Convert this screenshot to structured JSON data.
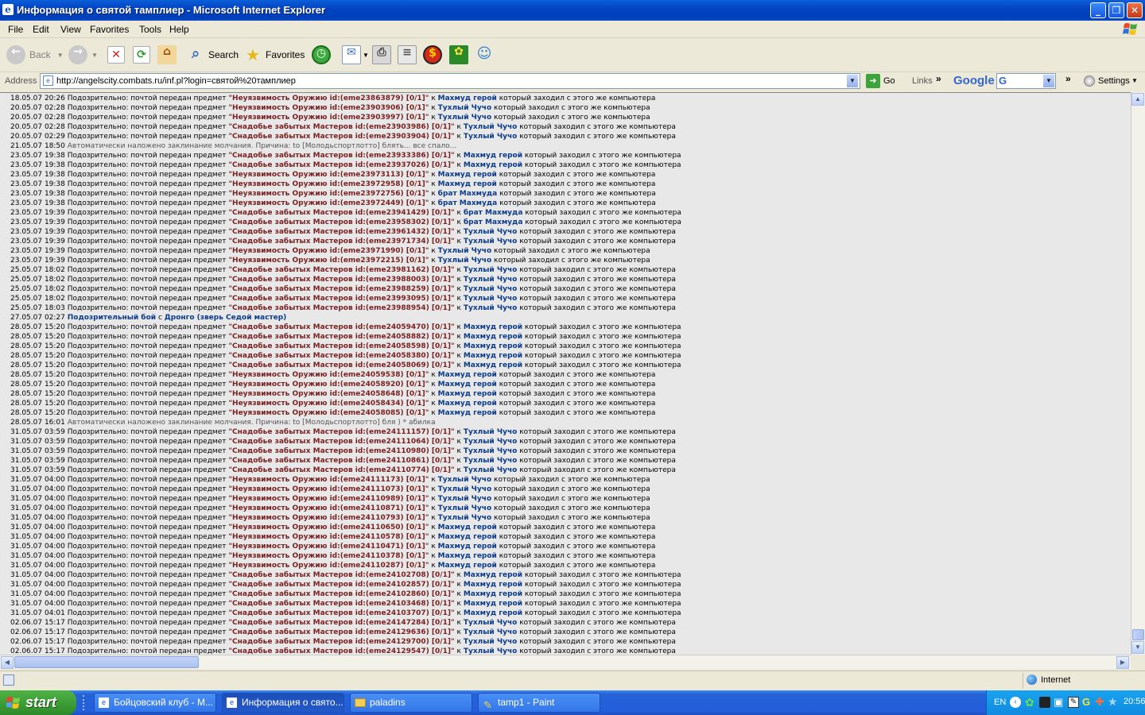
{
  "window": {
    "title": "Информация о святой тамплиер - Microsoft Internet Explorer"
  },
  "menu": [
    "File",
    "Edit",
    "View",
    "Favorites",
    "Tools",
    "Help"
  ],
  "toolbar": {
    "back": "Back",
    "search": "Search",
    "favorites": "Favorites"
  },
  "address": {
    "label": "Address",
    "url": "http://angelscity.combats.ru/inf.pl?login=святой%20тамплиер",
    "go": "Go",
    "links": "Links",
    "google": "Google",
    "settings": "Settings"
  },
  "log": {
    "phrases": {
      "suspicious": "Подозрительно: почтой передан предмет ",
      "to": " к ",
      "tail": " который заходил с этого же компьютера"
    },
    "rows": [
      {
        "d": "18.05.07 20:26",
        "item": "\"Неуязвимость Оружию id:(eme23863879) [0/1]\"",
        "nick": "Махмуд герой"
      },
      {
        "d": "20.05.07 02:28",
        "item": "\"Неуязвимость Оружию id:(eme23903906) [0/1]\"",
        "nick": "Тухлый Чучо"
      },
      {
        "d": "20.05.07 02:28",
        "item": "\"Неуязвимость Оружию id:(eme23903997) [0/1]\"",
        "nick": "Тухлый Чучо"
      },
      {
        "d": "20.05.07 02:28",
        "item": "\"Снадобье забытых Мастеров id:(eme23903986) [0/1]\"",
        "nick": "Тухлый Чучо"
      },
      {
        "d": "20.05.07 02:29",
        "item": "\"Снадобье забытых Мастеров id:(eme23903904) [0/1]\"",
        "nick": "Тухлый Чучо"
      },
      {
        "d": "21.05.07 18:50",
        "text": "Автоматически наложено заклинание молчания. Причина: to [Молодьспортлотто] блять... все спало..."
      },
      {
        "d": "23.05.07 19:38",
        "item": "\"Снадобье забытых Мастеров id:(eme23933386) [0/1]\"",
        "nick": "Махмуд герой"
      },
      {
        "d": "23.05.07 19:38",
        "item": "\"Снадобье забытых Мастеров id:(eme23937026) [0/1]\"",
        "nick": "Махмуд герой"
      },
      {
        "d": "23.05.07 19:38",
        "item": "\"Неуязвимость Оружию id:(eme23973113) [0/1]\"",
        "nick": "Махмуд герой"
      },
      {
        "d": "23.05.07 19:38",
        "item": "\"Неуязвимость Оружию id:(eme23972958) [0/1]\"",
        "nick": "Махмуд герой"
      },
      {
        "d": "23.05.07 19:38",
        "item": "\"Неуязвимость Оружию id:(eme23972756) [0/1]\"",
        "nick": "брат Махмуда"
      },
      {
        "d": "23.05.07 19:38",
        "item": "\"Неуязвимость Оружию id:(eme23972449) [0/1]\"",
        "nick": "брат Махмуда"
      },
      {
        "d": "23.05.07 19:39",
        "item": "\"Снадобье забытых Мастеров id:(eme23941429) [0/1]\"",
        "nick": "брат Махмуда"
      },
      {
        "d": "23.05.07 19:39",
        "item": "\"Снадобье забытых Мастеров id:(eme23958302) [0/1]\"",
        "nick": "брат Махмуда"
      },
      {
        "d": "23.05.07 19:39",
        "item": "\"Снадобье забытых Мастеров id:(eme23961432) [0/1]\"",
        "nick": "Тухлый Чучо"
      },
      {
        "d": "23.05.07 19:39",
        "item": "\"Снадобье забытых Мастеров id:(eme23971734) [0/1]\"",
        "nick": "Тухлый Чучо"
      },
      {
        "d": "23.05.07 19:39",
        "item": "\"Неуязвимость Оружию id:(eme23971990) [0/1]\"",
        "nick": "Тухлый Чучо"
      },
      {
        "d": "23.05.07 19:39",
        "item": "\"Неуязвимость Оружию id:(eme23972215) [0/1]\"",
        "nick": "Тухлый Чучо"
      },
      {
        "d": "25.05.07 18:02",
        "item": "\"Снадобье забытых Мастеров id:(eme23981162) [0/1]\"",
        "nick": "Тухлый Чучо"
      },
      {
        "d": "25.05.07 18:02",
        "item": "\"Снадобье забытых Мастеров id:(eme23988003) [0/1]\"",
        "nick": "Тухлый Чучо"
      },
      {
        "d": "25.05.07 18:02",
        "item": "\"Снадобье забытых Мастеров id:(eme23988259) [0/1]\"",
        "nick": "Тухлый Чучо"
      },
      {
        "d": "25.05.07 18:02",
        "item": "\"Снадобье забытых Мастеров id:(eme23993095) [0/1]\"",
        "nick": "Тухлый Чучо"
      },
      {
        "d": "25.05.07 18:03",
        "item": "\"Снадобье забытых Мастеров id:(eme23988954) [0/1]\"",
        "nick": "Тухлый Чучо"
      },
      {
        "d": "27.05.07 02:27",
        "fight": "Подозрительный бой",
        "with": " с ",
        "opp": "Дронго (зверь Седой мастер)"
      },
      {
        "d": "28.05.07 15:20",
        "item": "\"Снадобье забытых Мастеров id:(eme24059470) [0/1]\"",
        "nick": "Махмуд герой"
      },
      {
        "d": "28.05.07 15:20",
        "item": "\"Снадобье забытых Мастеров id:(eme24058882) [0/1]\"",
        "nick": "Махмуд герой"
      },
      {
        "d": "28.05.07 15:20",
        "item": "\"Снадобье забытых Мастеров id:(eme24058598) [0/1]\"",
        "nick": "Махмуд герой"
      },
      {
        "d": "28.05.07 15:20",
        "item": "\"Снадобье забытых Мастеров id:(eme24058380) [0/1]\"",
        "nick": "Махмуд герой"
      },
      {
        "d": "28.05.07 15:20",
        "item": "\"Снадобье забытых Мастеров id:(eme24058069) [0/1]\"",
        "nick": "Махмуд герой"
      },
      {
        "d": "28.05.07 15:20",
        "item": "\"Неуязвимость Оружию id:(eme24059538) [0/1]\"",
        "nick": "Махмуд герой"
      },
      {
        "d": "28.05.07 15:20",
        "item": "\"Неуязвимость Оружию id:(eme24058920) [0/1]\"",
        "nick": "Махмуд герой"
      },
      {
        "d": "28.05.07 15:20",
        "item": "\"Неуязвимость Оружию id:(eme24058648) [0/1]\"",
        "nick": "Махмуд герой"
      },
      {
        "d": "28.05.07 15:20",
        "item": "\"Неуязвимость Оружию id:(eme24058434) [0/1]\"",
        "nick": "Махмуд герой"
      },
      {
        "d": "28.05.07 15:20",
        "item": "\"Неуязвимость Оружию id:(eme24058085) [0/1]\"",
        "nick": "Махмуд герой"
      },
      {
        "d": "28.05.07 16:01",
        "text": "Автоматически наложено заклинание молчания. Причина: to [Молодьспортлотто] бля ) * абилка"
      },
      {
        "d": "31.05.07 03:59",
        "item": "\"Снадобье забытых Мастеров id:(eme24111157) [0/1]\"",
        "nick": "Тухлый Чучо"
      },
      {
        "d": "31.05.07 03:59",
        "item": "\"Снадобье забытых Мастеров id:(eme24111064) [0/1]\"",
        "nick": "Тухлый Чучо"
      },
      {
        "d": "31.05.07 03:59",
        "item": "\"Снадобье забытых Мастеров id:(eme24110980) [0/1]\"",
        "nick": "Тухлый Чучо"
      },
      {
        "d": "31.05.07 03:59",
        "item": "\"Снадобье забытых Мастеров id:(eme24110861) [0/1]\"",
        "nick": "Тухлый Чучо"
      },
      {
        "d": "31.05.07 03:59",
        "item": "\"Снадобье забытых Мастеров id:(eme24110774) [0/1]\"",
        "nick": "Тухлый Чучо"
      },
      {
        "d": "31.05.07 04:00",
        "item": "\"Неуязвимость Оружию id:(eme24111173) [0/1]\"",
        "nick": "Тухлый Чучо"
      },
      {
        "d": "31.05.07 04:00",
        "item": "\"Неуязвимость Оружию id:(eme24111073) [0/1]\"",
        "nick": "Тухлый Чучо"
      },
      {
        "d": "31.05.07 04:00",
        "item": "\"Неуязвимость Оружию id:(eme24110989) [0/1]\"",
        "nick": "Тухлый Чучо"
      },
      {
        "d": "31.05.07 04:00",
        "item": "\"Неуязвимость Оружию id:(eme24110871) [0/1]\"",
        "nick": "Тухлый Чучо"
      },
      {
        "d": "31.05.07 04:00",
        "item": "\"Неуязвимость Оружию id:(eme24110793) [0/1]\"",
        "nick": "Тухлый Чучо"
      },
      {
        "d": "31.05.07 04:00",
        "item": "\"Неуязвимость Оружию id:(eme24110650) [0/1]\"",
        "nick": "Махмуд герой"
      },
      {
        "d": "31.05.07 04:00",
        "item": "\"Неуязвимость Оружию id:(eme24110578) [0/1]\"",
        "nick": "Махмуд герой"
      },
      {
        "d": "31.05.07 04:00",
        "item": "\"Неуязвимость Оружию id:(eme24110471) [0/1]\"",
        "nick": "Махмуд герой"
      },
      {
        "d": "31.05.07 04:00",
        "item": "\"Неуязвимость Оружию id:(eme24110378) [0/1]\"",
        "nick": "Махмуд герой"
      },
      {
        "d": "31.05.07 04:00",
        "item": "\"Неуязвимость Оружию id:(eme24110287) [0/1]\"",
        "nick": "Махмуд герой"
      },
      {
        "d": "31.05.07 04:00",
        "item": "\"Снадобье забытых Мастеров id:(eme24102708) [0/1]\"",
        "nick": "Махмуд герой"
      },
      {
        "d": "31.05.07 04:00",
        "item": "\"Снадобье забытых Мастеров id:(eme24102857) [0/1]\"",
        "nick": "Махмуд герой"
      },
      {
        "d": "31.05.07 04:00",
        "item": "\"Снадобье забытых Мастеров id:(eme24102860) [0/1]\"",
        "nick": "Махмуд герой"
      },
      {
        "d": "31.05.07 04:00",
        "item": "\"Снадобье забытых Мастеров id:(eme24103468) [0/1]\"",
        "nick": "Махмуд герой"
      },
      {
        "d": "31.05.07 04:01",
        "item": "\"Снадобье забытых Мастеров id:(eme24103707) [0/1]\"",
        "nick": "Махмуд герой"
      },
      {
        "d": "02.06.07 15:17",
        "item": "\"Снадобье забытых Мастеров id:(eme24147284) [0/1]\"",
        "nick": "Тухлый Чучо"
      },
      {
        "d": "02.06.07 15:17",
        "item": "\"Снадобье забытых Мастеров id:(eme24129636) [0/1]\"",
        "nick": "Тухлый Чучо"
      },
      {
        "d": "02.06.07 15:17",
        "item": "\"Снадобье забытых Мастеров id:(eme24129700) [0/1]\"",
        "nick": "Тухлый Чучо"
      },
      {
        "d": "02.06.07 15:17",
        "item": "\"Снадобье забытых Мастеров id:(eme24129547) [0/1]\"",
        "nick": "Тухлый Чучо"
      }
    ]
  },
  "status": {
    "zone": "Internet"
  },
  "taskbar": {
    "start": "start",
    "tasks": [
      "Бойцовский клуб - M...",
      "Информация о свято...",
      "paladins",
      "tamp1 - Paint"
    ],
    "lang": "EN",
    "clock": "20:56"
  },
  "colors": {
    "item": "#7a2222",
    "nick": "#0a3b8a",
    "titlebar": "#0343c2",
    "taskbar": "#245edb",
    "start": "#3a9a34"
  }
}
